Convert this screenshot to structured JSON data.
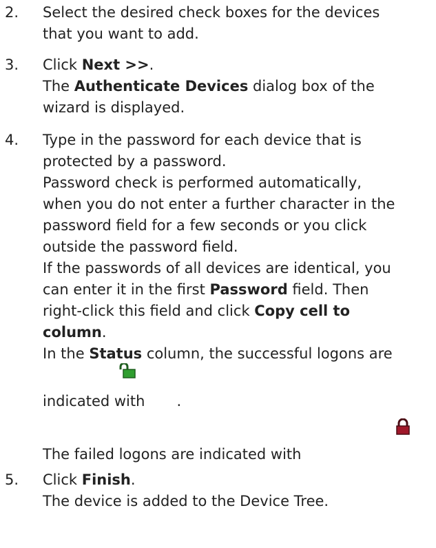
{
  "steps": [
    {
      "number": "2.",
      "lines": [
        "Select the desired check boxes for the devices",
        "that you want to add."
      ]
    },
    {
      "number": "3.",
      "click_prefix": "Click ",
      "click_target": "Next >>",
      "click_suffix": ".",
      "result_prefix": "The ",
      "result_bold": "Authenticate Devices",
      "result_suffix": " dialog box of the",
      "result_line2": "wizard is displayed."
    },
    {
      "number": "4.",
      "lines": [
        "Type in the password for each device that is",
        "protected by a password.",
        "Password check is performed automatically,",
        "when you do not enter a further character in the",
        "password field for a few seconds or you click",
        "outside the password field.",
        "If the passwords of all devices are identical, you"
      ],
      "enter_prefix": "can enter it in the first ",
      "enter_bold": "Password",
      "enter_suffix": " field. Then",
      "rightclick_prefix": "right-click this field and click ",
      "rightclick_bold_1": "Copy cell to",
      "rightclick_bold_2": "column",
      "rightclick_suffix": ".",
      "status_prefix": "In the ",
      "status_bold": "Status",
      "status_suffix": " column, the successful logons are",
      "success_text": "indicated with",
      "success_period": ".",
      "failed_text": "The failed logons are indicated with"
    },
    {
      "number": "5.",
      "click_prefix": "Click ",
      "click_target": "Finish",
      "click_suffix": ".",
      "result": "The device is added to the Device Tree."
    }
  ],
  "icons": {
    "success": "unlocked-padlock-icon",
    "failed": "locked-padlock-icon",
    "success_color": "#2f9e2f",
    "failed_color": "#a0182a"
  }
}
